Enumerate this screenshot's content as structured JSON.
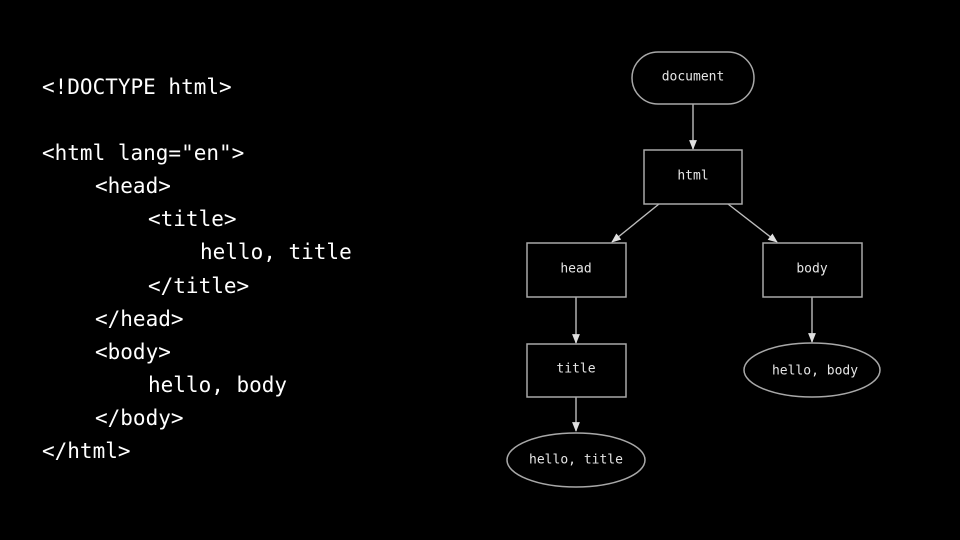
{
  "code": {
    "lines": [
      {
        "indent": 0,
        "text": "<!DOCTYPE html>"
      },
      {
        "indent": 0,
        "text": ""
      },
      {
        "indent": 0,
        "text": "<html lang=\"en\">"
      },
      {
        "indent": 1,
        "text": "<head>"
      },
      {
        "indent": 2,
        "text": "<title>"
      },
      {
        "indent": 3,
        "text": "hello, title"
      },
      {
        "indent": 2,
        "text": "</title>"
      },
      {
        "indent": 1,
        "text": "</head>"
      },
      {
        "indent": 1,
        "text": "<body>"
      },
      {
        "indent": 2,
        "text": "hello, body"
      },
      {
        "indent": 1,
        "text": "</body>"
      },
      {
        "indent": 0,
        "text": "</html>"
      }
    ]
  },
  "tree": {
    "nodes": {
      "document": {
        "label": "document",
        "shape": "pill"
      },
      "html": {
        "label": "html",
        "shape": "rect"
      },
      "head": {
        "label": "head",
        "shape": "rect"
      },
      "body": {
        "label": "body",
        "shape": "rect"
      },
      "title": {
        "label": "title",
        "shape": "rect"
      },
      "body_text": {
        "label": "hello, body",
        "shape": "ellipse"
      },
      "title_text": {
        "label": "hello, title",
        "shape": "ellipse"
      }
    },
    "edges": [
      {
        "from": "document",
        "to": "html"
      },
      {
        "from": "html",
        "to": "head"
      },
      {
        "from": "html",
        "to": "body"
      },
      {
        "from": "head",
        "to": "title"
      },
      {
        "from": "body",
        "to": "body_text"
      },
      {
        "from": "title",
        "to": "title_text"
      }
    ]
  },
  "colors": {
    "background": "#000000",
    "code_text": "#ffffff",
    "node_stroke": "#a8a8a8",
    "node_text": "#e6e6e6"
  }
}
